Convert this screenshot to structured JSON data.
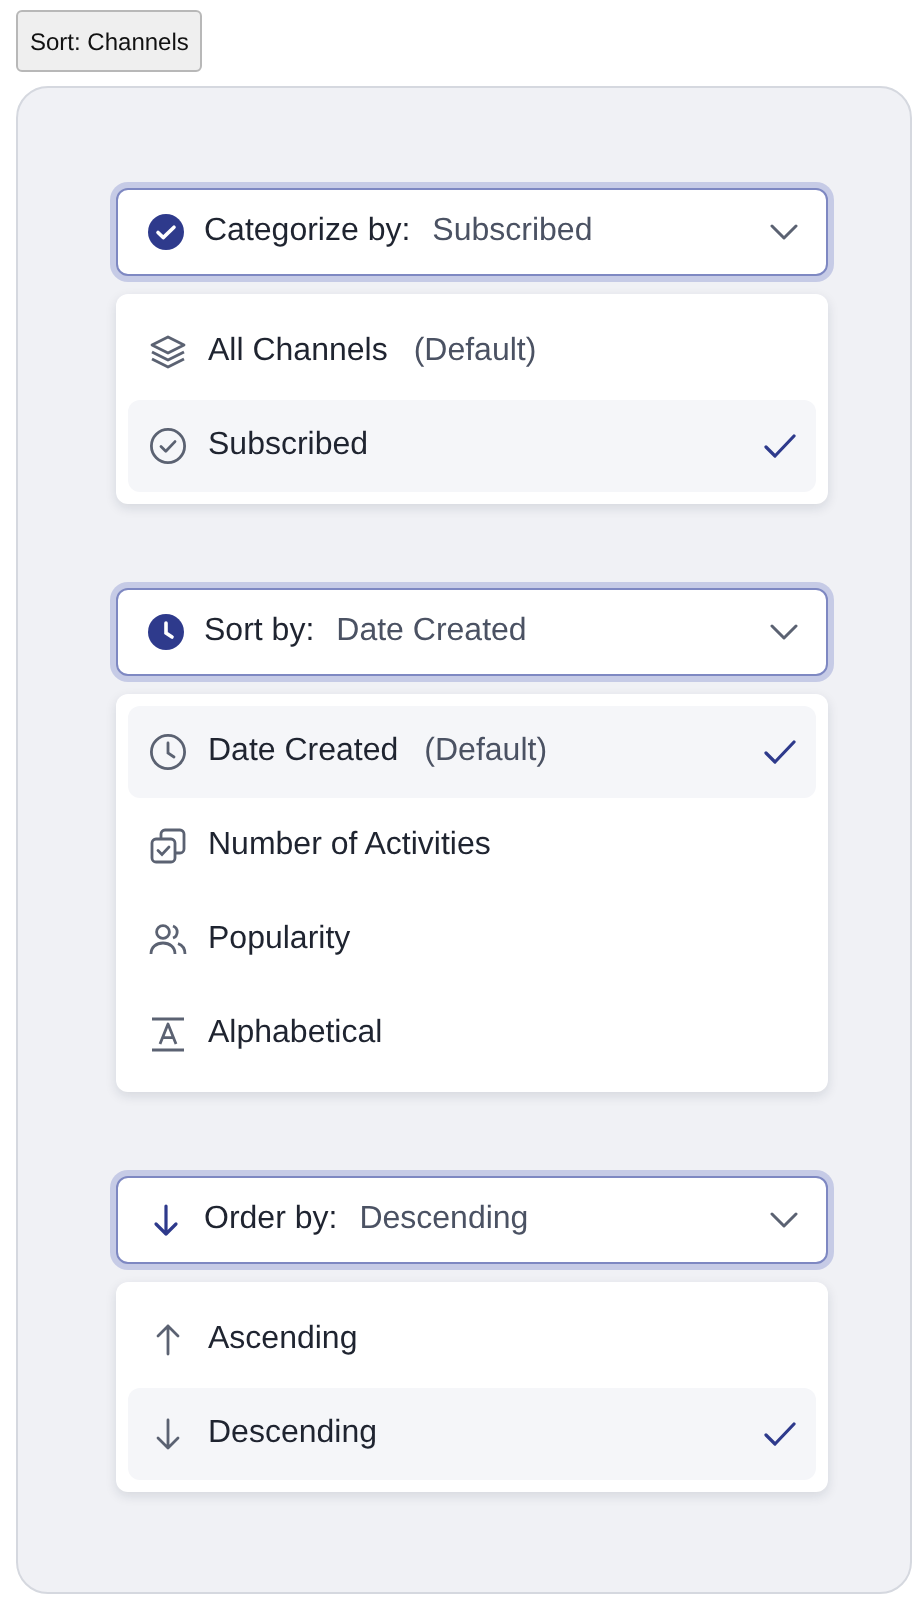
{
  "button": {
    "label": "Sort: Channels"
  },
  "dropdowns": [
    {
      "label": "Categorize by:",
      "value": "Subscribed",
      "options": [
        {
          "label": "All Channels",
          "note": "(Default)",
          "selected": false
        },
        {
          "label": "Subscribed",
          "selected": true
        }
      ]
    },
    {
      "label": "Sort by:",
      "value": "Date Created",
      "options": [
        {
          "label": "Date Created",
          "note": "(Default)",
          "selected": true
        },
        {
          "label": "Number of Activities",
          "selected": false
        },
        {
          "label": "Popularity",
          "selected": false
        },
        {
          "label": "Alphabetical",
          "selected": false
        }
      ]
    },
    {
      "label": "Order by:",
      "value": "Descending",
      "options": [
        {
          "label": "Ascending",
          "selected": false
        },
        {
          "label": "Descending",
          "selected": true
        }
      ]
    }
  ]
}
